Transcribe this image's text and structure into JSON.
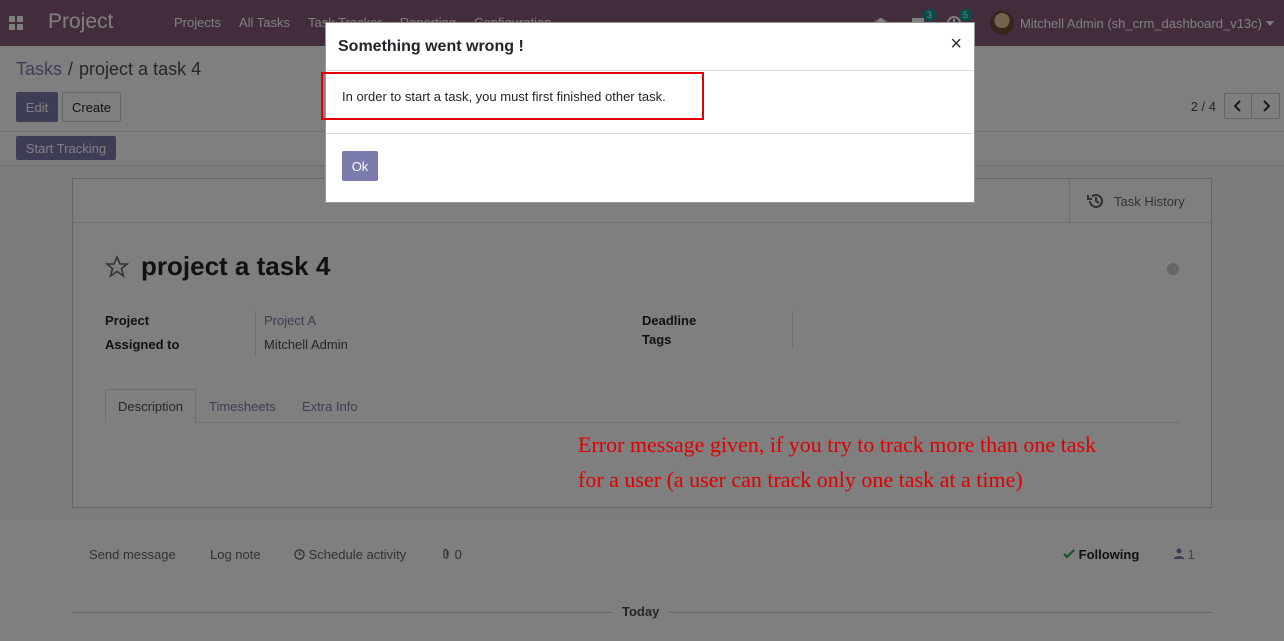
{
  "navbar": {
    "brand": "Project",
    "menu": [
      "Projects",
      "All Tasks",
      "Task Tracker",
      "Reporting",
      "Configuration"
    ],
    "messages_count": "3",
    "activities_count": "5",
    "user_name": "Mitchell Admin (sh_crm_dashboard_v13c)"
  },
  "breadcrumb": {
    "parent": "Tasks",
    "separator": "/",
    "current": "project a task 4"
  },
  "buttons": {
    "edit": "Edit",
    "create": "Create",
    "start_tracking": "Start Tracking"
  },
  "pager": {
    "value": "2 / 4"
  },
  "stat_button": {
    "task_history": "Task History"
  },
  "form": {
    "title": "project a task 4",
    "project_label": "Project",
    "project_value": "Project A",
    "assigned_label": "Assigned to",
    "assigned_value": "Mitchell Admin",
    "deadline_label": "Deadline",
    "tags_label": "Tags"
  },
  "tabs": [
    "Description",
    "Timesheets",
    "Extra Info"
  ],
  "annotation": {
    "line1": "Error message given, if you try to track more than one task",
    "line2": "for a user (a user can track only one task at a time)"
  },
  "chatter": {
    "send_message": "Send message",
    "log_note": "Log note",
    "schedule_activity": "Schedule activity",
    "attachments_count": "0",
    "following": "Following",
    "followers_count": "1",
    "today": "Today"
  },
  "dialog": {
    "title": "Something went wrong !",
    "close": "×",
    "message": "In order to start a task, you must first finished other task.",
    "ok": "Ok"
  },
  "colors": {
    "brand": "#875a7b",
    "primary": "#7c7bad",
    "annotation": "#e00000"
  }
}
